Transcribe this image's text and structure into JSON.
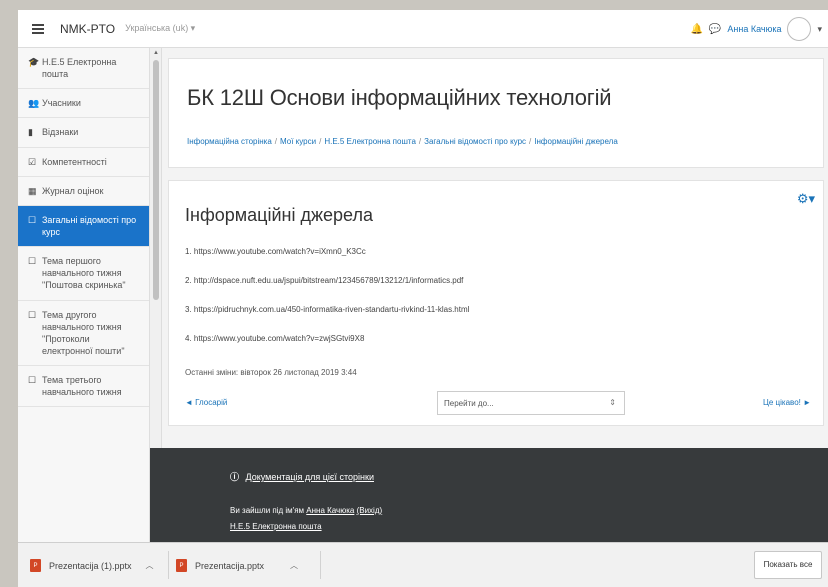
{
  "navbar": {
    "brand": "NMK-PTO",
    "language": "Українська (uk) ▾",
    "username": "Анна Качюка",
    "caret": "▾"
  },
  "sidebar": {
    "items": [
      {
        "icon": "graduation-cap-icon",
        "glyph": "🎓",
        "label": "Н.Е.5 Електронна пошта"
      },
      {
        "icon": "users-icon",
        "glyph": "👥",
        "label": "Учасники"
      },
      {
        "icon": "badge-icon",
        "glyph": "▮",
        "label": "Відзнаки"
      },
      {
        "icon": "checkbox-icon",
        "glyph": "☑",
        "label": "Компетентності"
      },
      {
        "icon": "gradebook-icon",
        "glyph": "▦",
        "label": "Журнал оцінок"
      },
      {
        "icon": "folder-icon",
        "glyph": "☐",
        "label": "Загальні відомості про курс",
        "active": true
      },
      {
        "icon": "folder-icon",
        "glyph": "☐",
        "label": "Тема першого навчального тижня \"Поштова скринька\""
      },
      {
        "icon": "folder-icon",
        "glyph": "☐",
        "label": "Тема другого навчального тижня \"Протоколи електронної пошти\""
      },
      {
        "icon": "folder-icon",
        "glyph": "☐",
        "label": "Тема третього навчального тижня"
      }
    ]
  },
  "header": {
    "title": "БК 12Ш Основи інформаційних технологій",
    "breadcrumb": [
      "Інформаційна сторінка",
      "Мої курси",
      "Н.Е.5 Електронна пошта",
      "Загальні відомості про курс",
      "Інформаційні джерела"
    ]
  },
  "content": {
    "section_title": "Інформаційні джерела",
    "links": [
      "1. https://www.youtube.com/watch?v=iXmn0_K3Cc",
      "2. http://dspace.nuft.edu.ua/jspui/bitstream/123456789/13212/1/informatics.pdf",
      "3. https://pidruchnyk.com.ua/450-informatika-riven-standartu-rivkind-11-klas.html",
      "4. https://www.youtube.com/watch?v=zwjSGtvi9X8"
    ],
    "modified": "Останні зміни: вівторок 26 листопад 2019 3:44",
    "prev": "◄ Глосарій",
    "jump_placeholder": "Перейти до...",
    "next": "Це цікаво! ►"
  },
  "footer": {
    "doc_link": "Документація для цієї сторінки",
    "login_prefix": "Ви зайшли під ім'ям",
    "login_name": "Анна Качюка",
    "logout": "(Вихід)",
    "course_link": "Н.Е.5 Електронна пошта"
  },
  "downloads": {
    "items": [
      {
        "name": "Prezentacija (1).pptx"
      },
      {
        "name": "Prezentacija.pptx"
      }
    ],
    "show_all": "Показать все"
  }
}
